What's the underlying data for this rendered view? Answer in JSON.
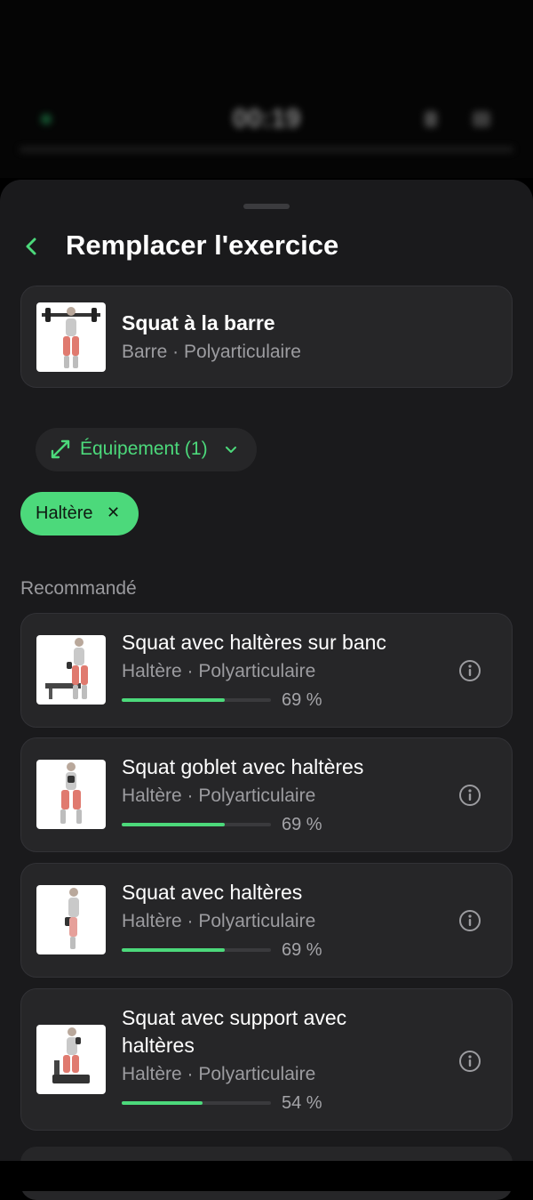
{
  "background": {
    "timer": "00:19"
  },
  "header": {
    "title": "Remplacer l'exercice"
  },
  "current": {
    "name": "Squat à la barre",
    "meta": "Barre · Polyarticulaire"
  },
  "filter": {
    "label": "Équipement (1)"
  },
  "chip": {
    "label": "Haltère",
    "close": "✕"
  },
  "section_title": "Recommandé",
  "exercises": [
    {
      "name": "Squat avec haltères sur banc",
      "meta": "Haltère · Polyarticulaire",
      "match": "69 %",
      "match_fraction": 0.69
    },
    {
      "name": "Squat goblet avec haltères",
      "meta": "Haltère · Polyarticulaire",
      "match": "69 %",
      "match_fraction": 0.69
    },
    {
      "name": "Squat avec haltères",
      "meta": "Haltère · Polyarticulaire",
      "match": "69 %",
      "match_fraction": 0.69
    },
    {
      "name": "Squat avec support avec haltères",
      "meta": "Haltère · Polyarticulaire",
      "match": "54 %",
      "match_fraction": 0.54
    }
  ],
  "colors": {
    "accent": "#4cd97b",
    "sheet": "#1a1a1c",
    "card": "#262628",
    "muted": "#9c9ca0"
  },
  "icons": [
    "back-chevron-icon",
    "info-icon",
    "equipment-icon",
    "chevron-down-icon",
    "close-icon",
    "exercise-illustration"
  ]
}
